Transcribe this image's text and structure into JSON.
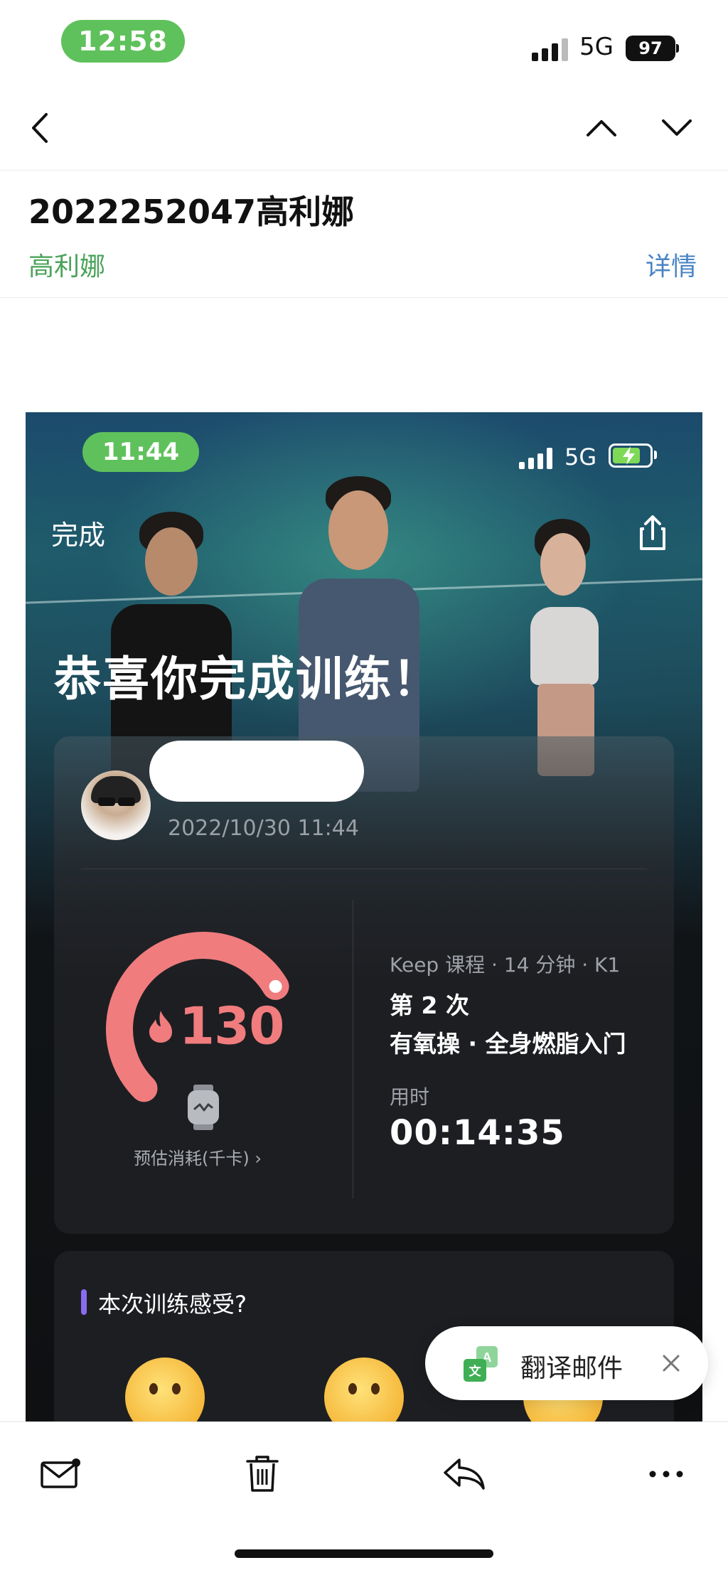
{
  "status_bar": {
    "time": "12:58",
    "network": "5G",
    "battery": "97"
  },
  "nav": {
    "back_icon": "chevron-left-icon",
    "prev_icon": "chevron-up-icon",
    "next_icon": "chevron-down-icon"
  },
  "mail": {
    "subject": "2022252047高利娜",
    "sender": "高利娜",
    "details_label": "详情"
  },
  "screenshot": {
    "status": {
      "time": "11:44",
      "network": "5G"
    },
    "done_label": "完成",
    "share_icon": "share-icon",
    "congrats": "恭喜你完成训练！",
    "post_time": "2022/10/30 11:44",
    "calories": {
      "value": "130",
      "label": "预估消耗(千卡)  ›",
      "gauge_fraction": 0.72,
      "accent": "#f07c7e"
    },
    "course": {
      "meta": "Keep 课程 · 14 分钟 · K1",
      "attempt": "第 2 次",
      "name": "有氧操 · 全身燃脂入门",
      "duration_label": "用时",
      "duration_value": "00:14:35"
    },
    "feeling_title": "本次训练感受?"
  },
  "toast": {
    "label": "翻译邮件",
    "icon": "translate-icon",
    "close_icon": "close-icon"
  },
  "toolbar": {
    "items": [
      "mail-unread-icon",
      "trash-icon",
      "reply-icon",
      "more-icon"
    ]
  },
  "colors": {
    "brand_green": "#5fc15b",
    "link_blue": "#4b84c4",
    "sender_green": "#4aa35a",
    "feel_accent": "#8a6cf0"
  }
}
